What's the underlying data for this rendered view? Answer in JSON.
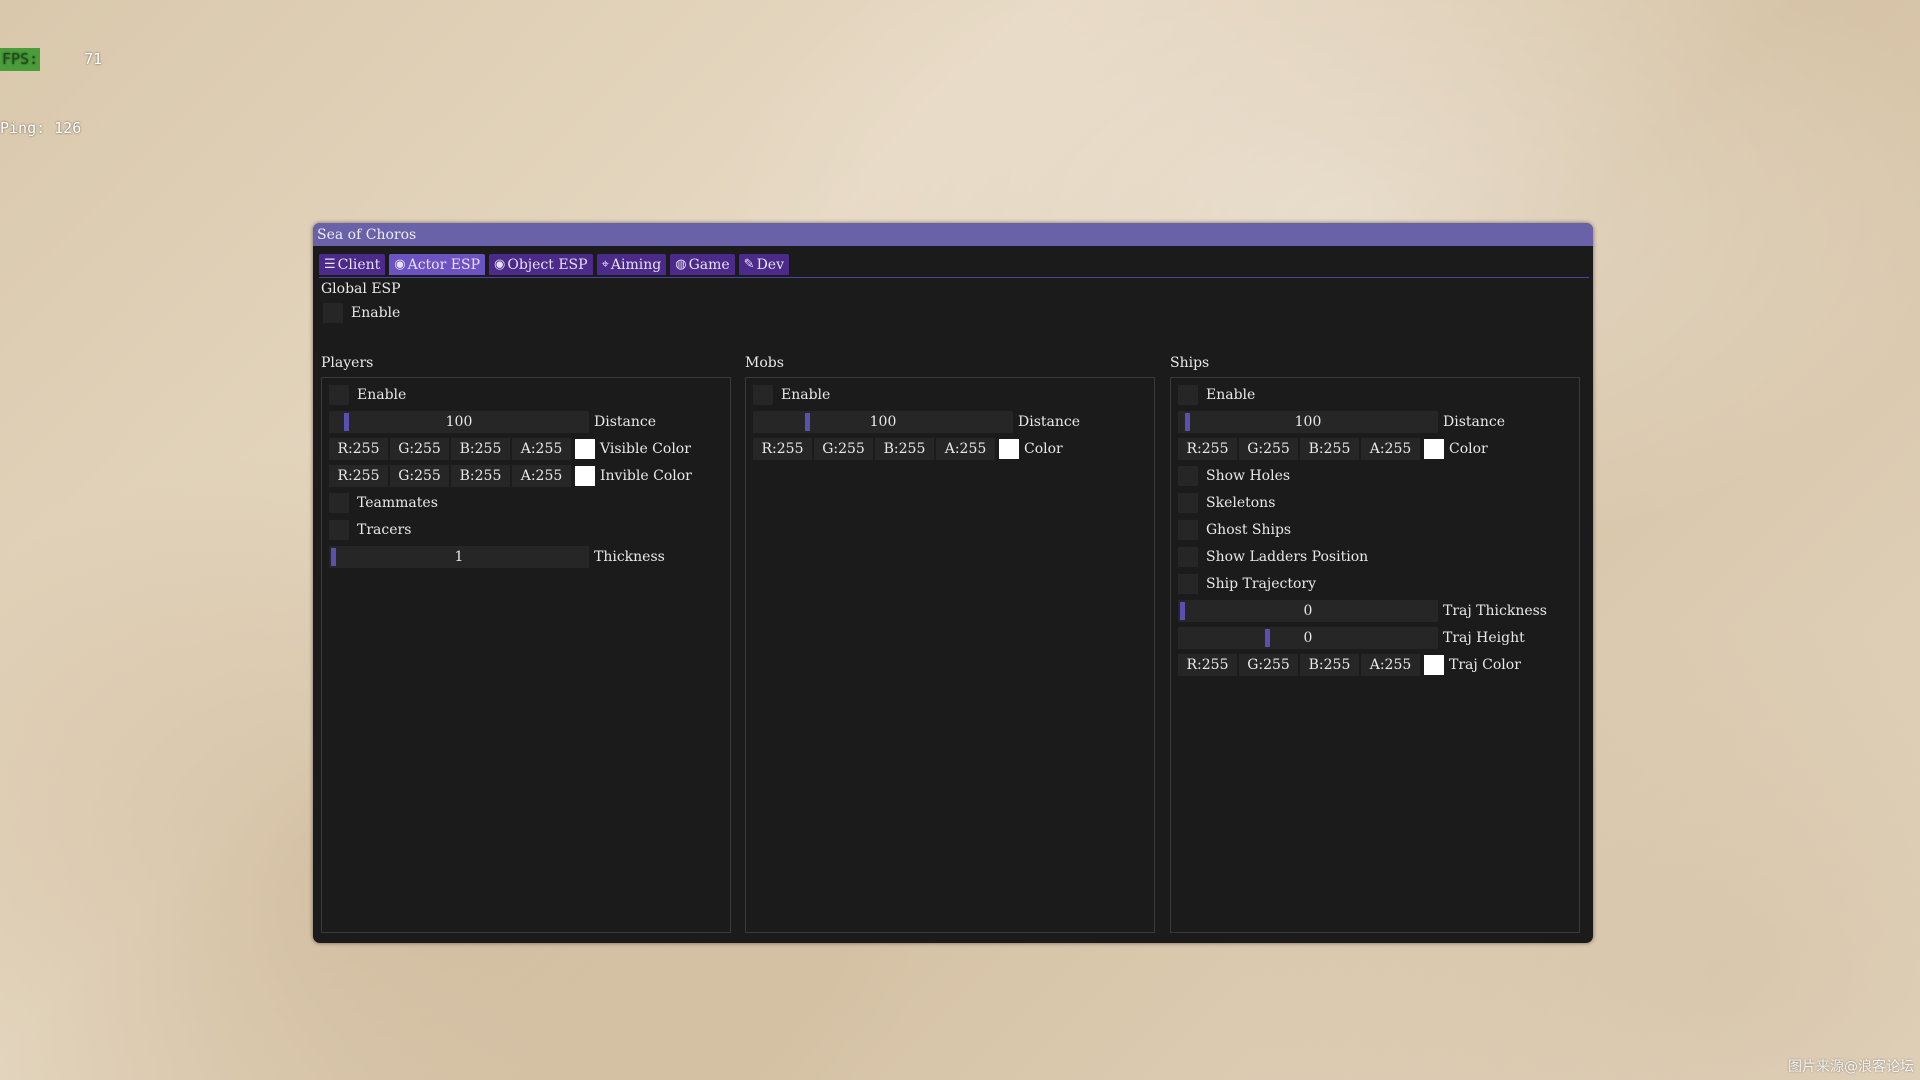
{
  "overlay": {
    "fps_label": "FPS:",
    "fps_value": "71",
    "ping_label": "Ping:",
    "ping_value": "126",
    "watermark": "图片来源@浪客论坛"
  },
  "window": {
    "title": "Sea of Choros",
    "accent_color": "#6a62a8",
    "tabs": [
      {
        "label": "Client",
        "icon": "sliders-icon",
        "glyph": "☰"
      },
      {
        "label": "Actor ESP",
        "icon": "eye-icon",
        "glyph": "◉",
        "active": true
      },
      {
        "label": "Object ESP",
        "icon": "eye-icon",
        "glyph": "◉"
      },
      {
        "label": "Aiming",
        "icon": "crosshair-icon",
        "glyph": "⌖"
      },
      {
        "label": "Game",
        "icon": "globe-icon",
        "glyph": "◍"
      },
      {
        "label": "Dev",
        "icon": "wrench-icon",
        "glyph": "✎"
      }
    ]
  },
  "global": {
    "label": "Global ESP",
    "enable": "Enable"
  },
  "players": {
    "title": "Players",
    "enable": "Enable",
    "distance": {
      "value": "100",
      "label": "Distance",
      "fraction": 0.05
    },
    "visible_color": {
      "r": "R:255",
      "g": "G:255",
      "b": "B:255",
      "a": "A:255",
      "label": "Visible Color"
    },
    "invisible_color": {
      "r": "R:255",
      "g": "G:255",
      "b": "B:255",
      "a": "A:255",
      "label": "Invible Color"
    },
    "teammates": "Teammates",
    "tracers": "Tracers",
    "thickness": {
      "value": "1",
      "label": "Thickness",
      "fraction": 0.0
    }
  },
  "mobs": {
    "title": "Mobs",
    "enable": "Enable",
    "distance": {
      "value": "100",
      "label": "Distance",
      "fraction": 0.2
    },
    "color": {
      "r": "R:255",
      "g": "G:255",
      "b": "B:255",
      "a": "A:255",
      "label": "Color"
    }
  },
  "ships": {
    "title": "Ships",
    "enable": "Enable",
    "distance": {
      "value": "100",
      "label": "Distance",
      "fraction": 0.02
    },
    "color": {
      "r": "R:255",
      "g": "G:255",
      "b": "B:255",
      "a": "A:255",
      "label": "Color"
    },
    "show_holes": "Show Holes",
    "skeletons": "Skeletons",
    "ghost_ships": "Ghost Ships",
    "show_ladders": "Show Ladders Position",
    "ship_trajectory": "Ship Trajectory",
    "traj_thickness": {
      "value": "0",
      "label": "Traj Thickness",
      "fraction": 0.0
    },
    "traj_height": {
      "value": "0",
      "label": "Traj Height",
      "fraction": 0.34
    },
    "traj_color": {
      "r": "R:255",
      "g": "G:255",
      "b": "B:255",
      "a": "A:255",
      "label": "Traj Color"
    }
  }
}
